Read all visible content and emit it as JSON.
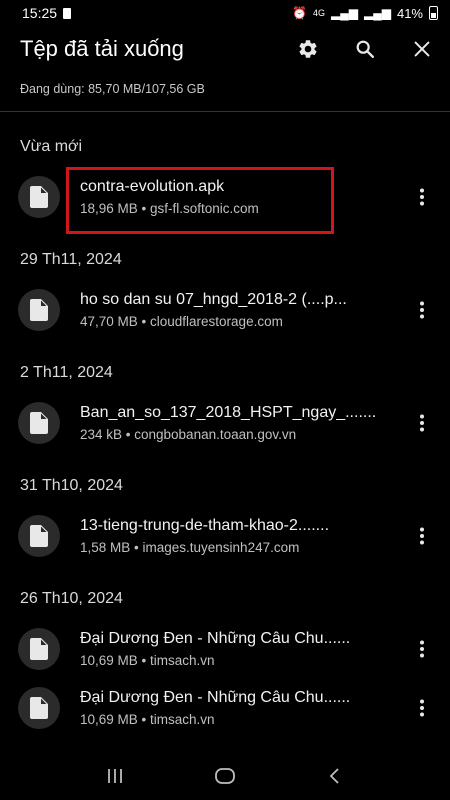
{
  "status_bar": {
    "time": "15:25",
    "network": "4G",
    "battery": "41%"
  },
  "app_bar": {
    "title": "Tệp đã tải xuống",
    "actions": [
      "gear-icon",
      "search-icon",
      "close-icon"
    ]
  },
  "storage": {
    "text": "Đang dùng: 85,70 MB/107,56 GB"
  },
  "sections": [
    {
      "header": "Vừa mới",
      "files": [
        {
          "name": "contra-evolution.apk",
          "meta": "18,96 MB • gsf-fl.softonic.com",
          "highlighted": true
        }
      ]
    },
    {
      "header": "29 Th11, 2024",
      "files": [
        {
          "name": "ho so dan su 07_hngd_2018-2 (....p...",
          "meta": "47,70 MB • cloudflarestorage.com"
        }
      ]
    },
    {
      "header": "2 Th11, 2024",
      "files": [
        {
          "name": "Ban_an_so_137_2018_HSPT_ngay_.......",
          "meta": "234 kB • congbobanan.toaan.gov.vn"
        }
      ]
    },
    {
      "header": "31 Th10, 2024",
      "files": [
        {
          "name": "13-tieng-trung-de-tham-khao-2.......",
          "meta": "1,58 MB • images.tuyensinh247.com"
        }
      ]
    },
    {
      "header": "26 Th10, 2024",
      "files": [
        {
          "name": "Đại Dương Đen - Những Câu Chu......",
          "meta": "10,69 MB • timsach.vn"
        },
        {
          "name": "Đại Dương Đen - Những Câu Chu......",
          "meta": "10,69 MB • timsach.vn"
        }
      ]
    }
  ],
  "colors": {
    "background": "#000000",
    "highlight_border": "#d0161c",
    "icon_circle": "#2b2b2b"
  }
}
